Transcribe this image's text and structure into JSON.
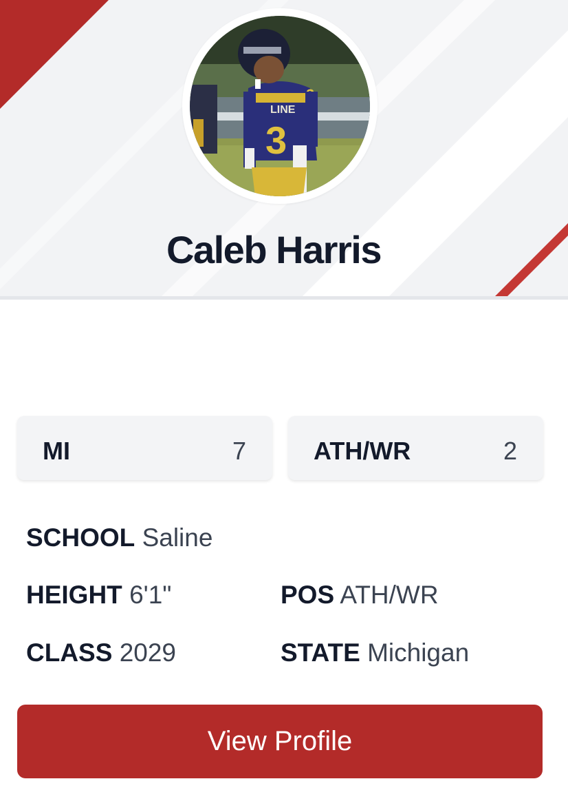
{
  "player": {
    "name": "Caleb Harris",
    "photo_jersey_text": "LINE",
    "photo_jersey_number": "3"
  },
  "rankings": [
    {
      "label": "MI",
      "value": "7"
    },
    {
      "label": "ATH/WR",
      "value": "2"
    }
  ],
  "details": {
    "school": {
      "key": "SCHOOL",
      "value": "Saline"
    },
    "height": {
      "key": "HEIGHT",
      "value": "6'1\""
    },
    "position": {
      "key": "POS",
      "value": "ATH/WR"
    },
    "class": {
      "key": "CLASS",
      "value": "2029"
    },
    "state": {
      "key": "STATE",
      "value": "Michigan"
    }
  },
  "actions": {
    "view_profile_label": "View Profile"
  },
  "colors": {
    "accent_red": "#b32b29",
    "header_bg": "#f2f3f5",
    "card_bg": "#f3f4f6",
    "text_dark": "#131a2b",
    "text_muted": "#3b4351"
  }
}
